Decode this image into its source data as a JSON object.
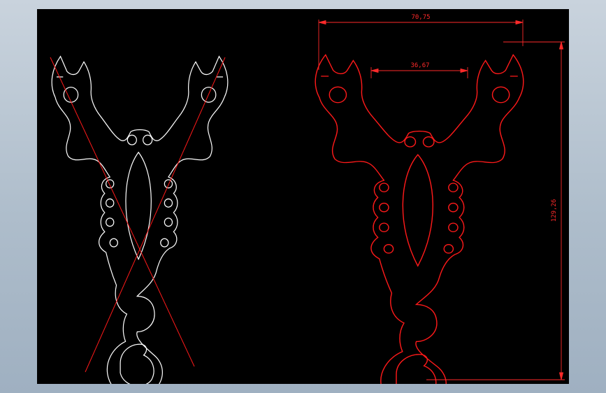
{
  "viewport": {
    "background": "#000000",
    "surround": "#b4c2cf"
  },
  "colors": {
    "white_geometry": "#ffffff",
    "red_geometry": "#ff1a1a",
    "dimension": "#ff2a2a"
  },
  "views": {
    "left": {
      "name": "crossed-out-draft-view",
      "crossed_out": true
    },
    "right": {
      "name": "dimensioned-view"
    }
  },
  "dimensions": {
    "overall_width": "70,75",
    "inner_width": "36,67",
    "overall_height": "129,26"
  }
}
